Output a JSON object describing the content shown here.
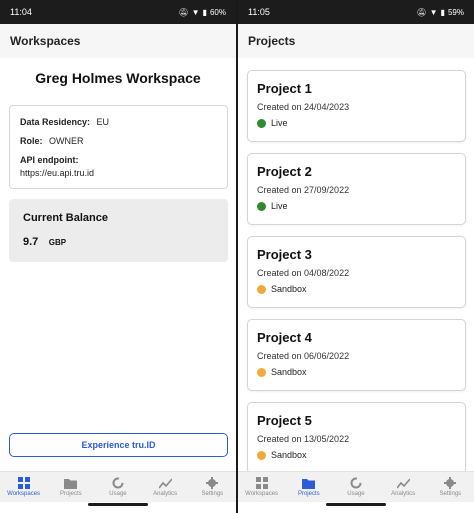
{
  "left": {
    "status": {
      "time": "11:04",
      "battery": "60%"
    },
    "header": {
      "title": "Workspaces"
    },
    "workspace": {
      "name": "Greg Holmes Workspace",
      "residency_label": "Data Residency:",
      "residency_value": "EU",
      "role_label": "Role:",
      "role_value": "OWNER",
      "endpoint_label": "API endpoint:",
      "endpoint_value": "https://eu.api.tru.id"
    },
    "balance": {
      "title": "Current Balance",
      "value": "9.7",
      "unit": "GBP"
    },
    "cta": {
      "label": "Experience tru.ID"
    },
    "tabs": [
      {
        "label": "Workspaces",
        "icon": "grid-icon"
      },
      {
        "label": "Projects",
        "icon": "folder-icon"
      },
      {
        "label": "Usage",
        "icon": "usage-ring-icon"
      },
      {
        "label": "Analytics",
        "icon": "chart-line-icon"
      },
      {
        "label": "Settings",
        "icon": "gear-icon"
      }
    ],
    "active_tab": 0
  },
  "right": {
    "status": {
      "time": "11:05",
      "battery": "59%"
    },
    "header": {
      "title": "Projects"
    },
    "projects": [
      {
        "name": "Project 1",
        "created": "Created on 24/04/2023",
        "status": "Live",
        "status_color": "#2e8b2e"
      },
      {
        "name": "Project 2",
        "created": "Created on 27/09/2022",
        "status": "Live",
        "status_color": "#2e8b2e"
      },
      {
        "name": "Project 3",
        "created": "Created on 04/08/2022",
        "status": "Sandbox",
        "status_color": "#f0a93b"
      },
      {
        "name": "Project 4",
        "created": "Created on 06/06/2022",
        "status": "Sandbox",
        "status_color": "#f0a93b"
      },
      {
        "name": "Project 5",
        "created": "Created on 13/05/2022",
        "status": "Sandbox",
        "status_color": "#f0a93b"
      }
    ],
    "tabs": [
      {
        "label": "Workspaces",
        "icon": "grid-icon"
      },
      {
        "label": "Projects",
        "icon": "folder-icon"
      },
      {
        "label": "Usage",
        "icon": "usage-ring-icon"
      },
      {
        "label": "Analytics",
        "icon": "chart-line-icon"
      },
      {
        "label": "Settings",
        "icon": "gear-icon"
      }
    ],
    "active_tab": 1
  },
  "colors": {
    "accent": "#2c5cd6",
    "inactive": "#8a8a8a"
  }
}
